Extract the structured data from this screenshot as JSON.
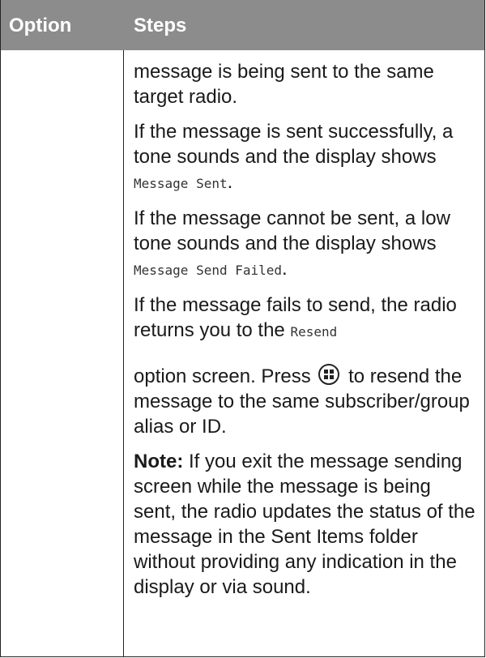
{
  "table": {
    "header": {
      "option": "Option",
      "steps": "Steps"
    },
    "steps": {
      "p1": "message is being sent to the same target radio.",
      "p2_text": "If the message is sent successfully, a tone sounds and the display shows ",
      "p2_code": "Message Sent",
      "p2_end": ".",
      "p3_text": "If the message cannot be sent, a low tone sounds and the display shows ",
      "p3_code": "Message Send Failed",
      "p3_end": ".",
      "p4_text": "If the message fails to send, the radio returns you to the ",
      "p4_code": "Resend",
      "p5_before": "option screen. Press ",
      "p5_icon": "menu-ok-button-icon",
      "p5_after": " to resend the message to the same subscriber/group alias or ID.",
      "note_label": "Note:",
      "note_text": " If you exit the message sending screen while the message is being sent, the radio updates the status of the message in the Sent Items folder without providing any indication in the display or via sound."
    }
  },
  "colors": {
    "header_bg": "#8c8c8c",
    "header_text": "#ffffff",
    "border": "#222222"
  }
}
